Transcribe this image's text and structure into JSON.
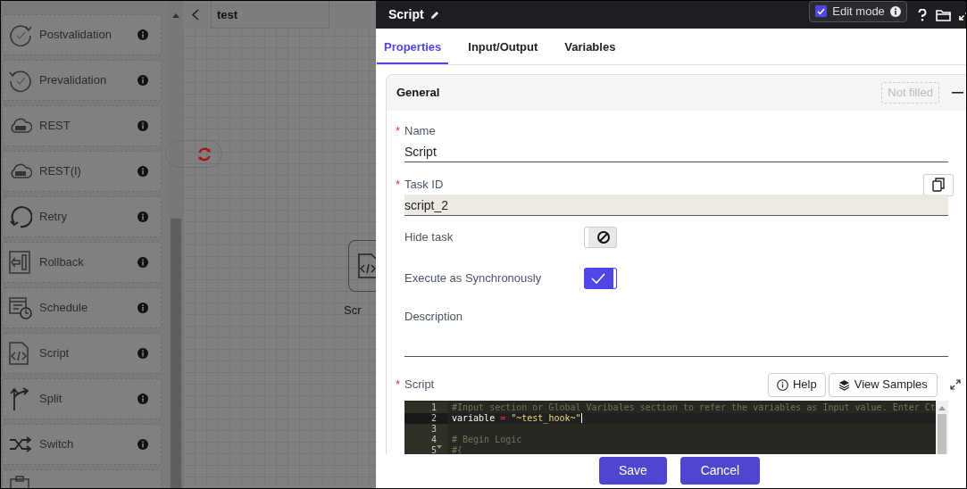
{
  "palette": {
    "items": [
      {
        "label": "Postvalidation",
        "kind": "check-cycle"
      },
      {
        "label": "Prevalidation",
        "kind": "check-cycle-back"
      },
      {
        "label": "REST",
        "kind": "api-cloud"
      },
      {
        "label": "REST(I)",
        "kind": "api-cloud"
      },
      {
        "label": "Retry",
        "kind": "retry"
      },
      {
        "label": "Rollback",
        "kind": "rollback"
      },
      {
        "label": "Schedule",
        "kind": "schedule"
      },
      {
        "label": "Script",
        "kind": "script"
      },
      {
        "label": "Split",
        "kind": "split"
      },
      {
        "label": "Switch",
        "kind": "switch"
      },
      {
        "kind": "clipboard"
      }
    ]
  },
  "canvas": {
    "tab": "test",
    "node_label": "Scr"
  },
  "panel": {
    "title": "Script",
    "edit_mode": {
      "label": "Edit mode",
      "checked": true
    },
    "tabs": [
      {
        "label": "Properties",
        "selected": true
      },
      {
        "label": "Input/Output",
        "selected": false
      },
      {
        "label": "Variables",
        "selected": false
      }
    ],
    "section": {
      "title": "General",
      "badge": "Not filled",
      "expanded": true,
      "fields": [
        {
          "kind": "text",
          "label": "Name",
          "marker": "*",
          "value": "Script"
        },
        {
          "kind": "readonly",
          "label": "Task ID",
          "marker": "*",
          "value": "script_2"
        },
        {
          "kind": "toggle",
          "label": "Hide task",
          "on": false
        },
        {
          "kind": "toggle",
          "label": "Execute as Synchronously",
          "on": true
        },
        {
          "kind": "text",
          "label": "Description"
        }
      ],
      "script": {
        "label": "Script",
        "marker": "*",
        "help": "Help",
        "samples": "View Samples",
        "lines": [
          {
            "number": "1",
            "tokens": [
              {
                "kind": "comment",
                "text": "#Input section or Global Varibales section to refer the variables as Input value. Enter Ct"
              }
            ]
          },
          {
            "number": "2",
            "active": true,
            "tokens": [
              {
                "kind": "plain",
                "text": "variable "
              },
              {
                "kind": "operator",
                "text": "= "
              },
              {
                "kind": "string",
                "text": "\"~test_hook~\""
              }
            ]
          },
          {
            "number": "3"
          },
          {
            "number": "4",
            "tokens": [
              {
                "kind": "comment",
                "text": "# Begin Logic"
              }
            ]
          },
          {
            "number": "5",
            "fold": true,
            "tokens": [
              {
                "kind": "comment",
                "text": "#{"
              }
            ]
          }
        ]
      }
    },
    "buttons": [
      "Save",
      "Cancel"
    ]
  }
}
